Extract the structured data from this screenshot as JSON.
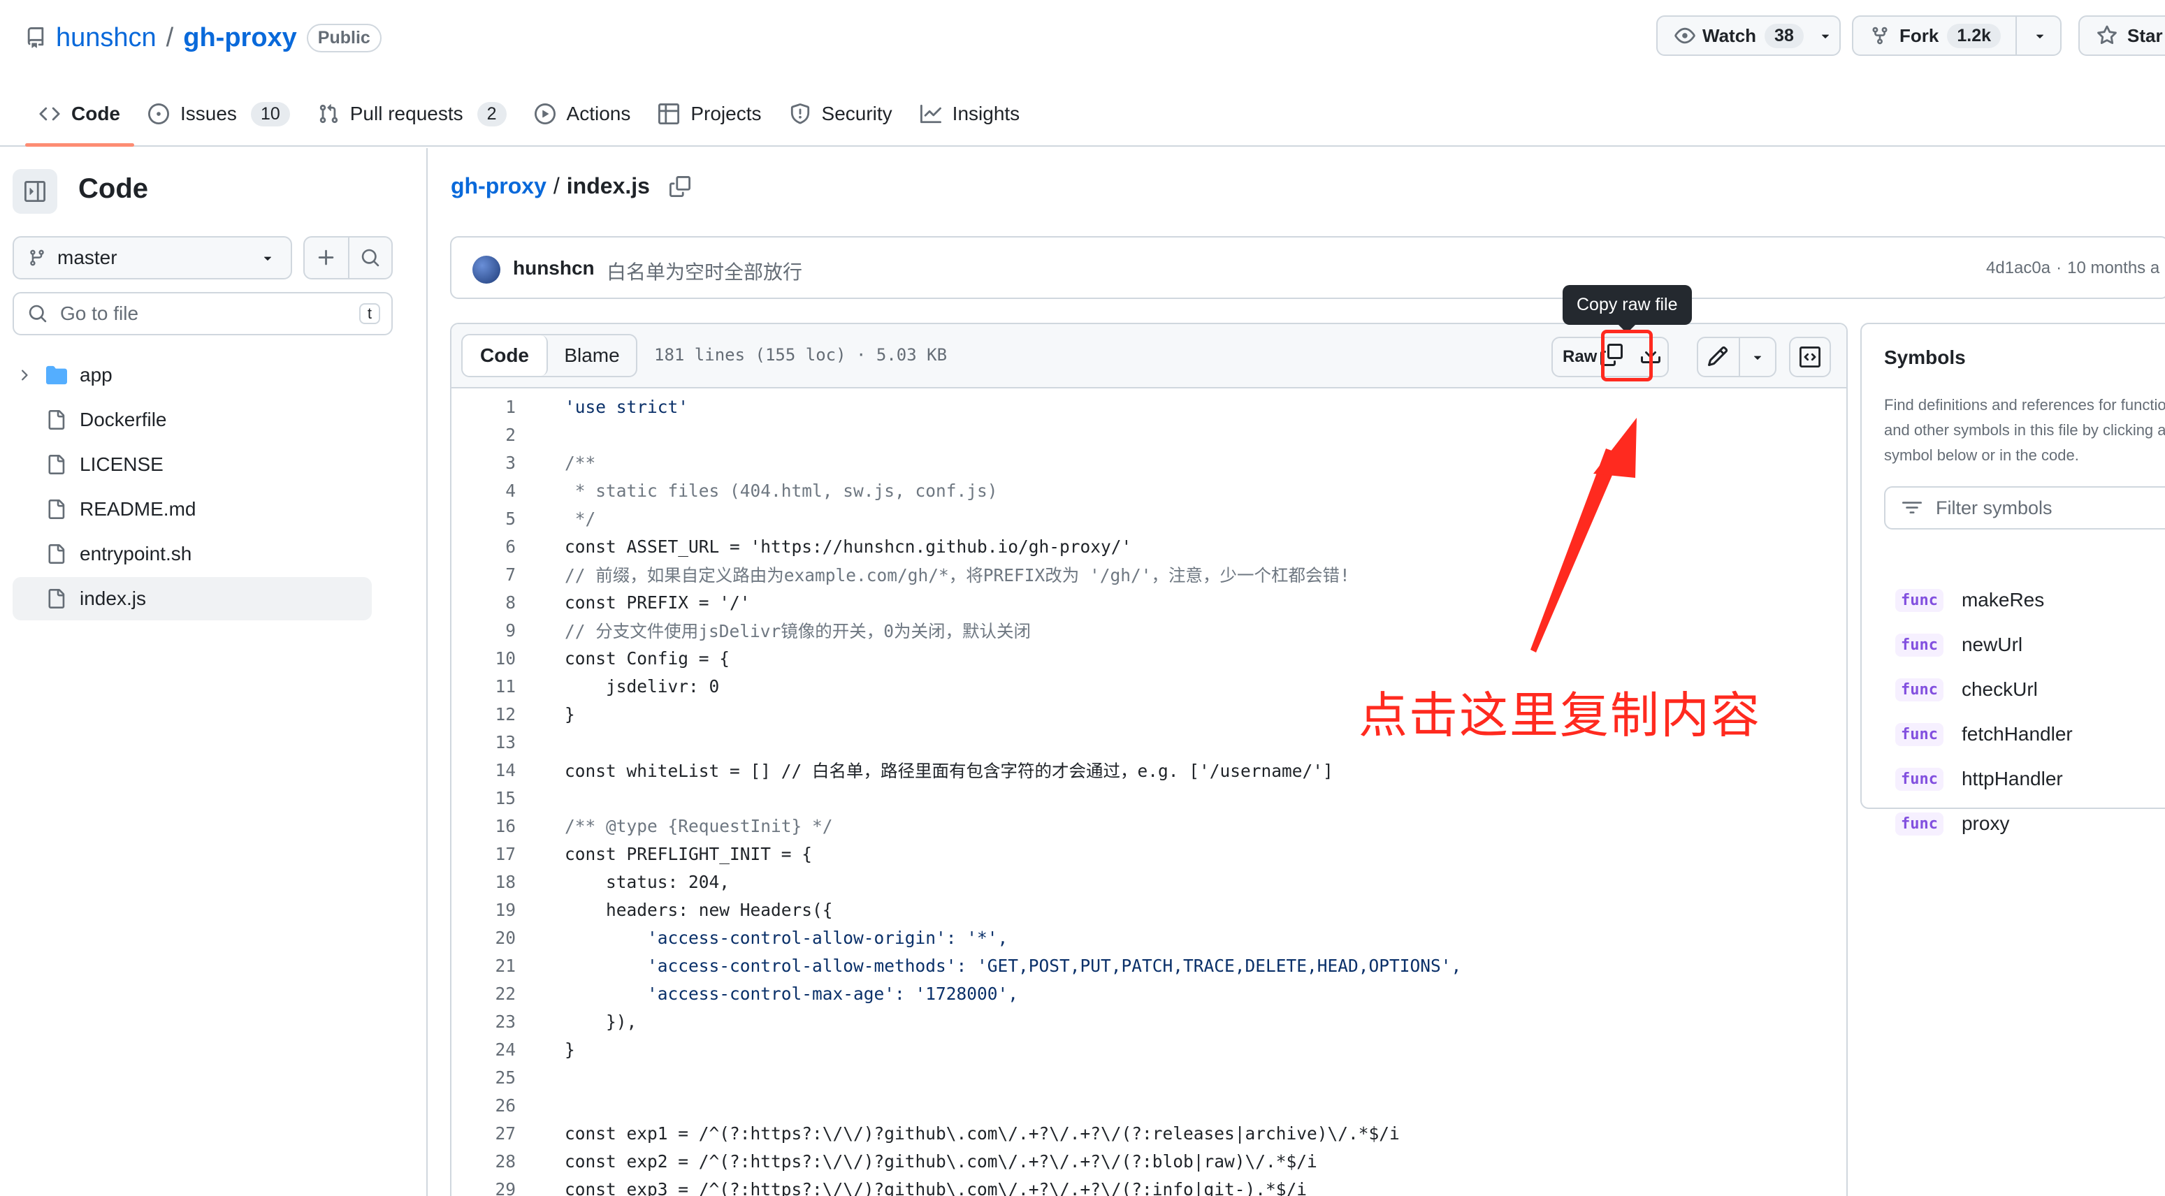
{
  "repo": {
    "owner": "hunshcn",
    "name": "gh-proxy",
    "visibility": "Public"
  },
  "header_actions": {
    "watch_label": "Watch",
    "watch_count": "38",
    "fork_label": "Fork",
    "fork_count": "1.2k",
    "star_label": "Star"
  },
  "tabs": [
    {
      "label": "Code",
      "count": null
    },
    {
      "label": "Issues",
      "count": "10"
    },
    {
      "label": "Pull requests",
      "count": "2"
    },
    {
      "label": "Actions",
      "count": null
    },
    {
      "label": "Projects",
      "count": null
    },
    {
      "label": "Security",
      "count": null
    },
    {
      "label": "Insights",
      "count": null
    }
  ],
  "sidebar": {
    "title": "Code",
    "branch": "master",
    "go_to_file_placeholder": "Go to file",
    "go_to_file_shortcut": "t",
    "files": [
      {
        "name": "app",
        "type": "folder"
      },
      {
        "name": "Dockerfile",
        "type": "file"
      },
      {
        "name": "LICENSE",
        "type": "file"
      },
      {
        "name": "README.md",
        "type": "file"
      },
      {
        "name": "entrypoint.sh",
        "type": "file"
      },
      {
        "name": "index.js",
        "type": "file"
      }
    ]
  },
  "breadcrumb": {
    "repo": "gh-proxy",
    "separator": "/",
    "file": "index.js"
  },
  "commit": {
    "author": "hunshcn",
    "message": "白名单为空时全部放行",
    "sha": "4d1ac0a",
    "separator": "·",
    "time": "10 months a"
  },
  "file_toolbar": {
    "code_tab": "Code",
    "blame_tab": "Blame",
    "meta": "181 lines (155 loc) · 5.03 KB",
    "raw_label": "Raw",
    "copy_tooltip": "Copy raw file"
  },
  "code_lines": [
    {
      "n": "1",
      "t": "'use strict'"
    },
    {
      "n": "2",
      "t": ""
    },
    {
      "n": "3",
      "t": "/**"
    },
    {
      "n": "4",
      "t": " * static files (404.html, sw.js, conf.js)"
    },
    {
      "n": "5",
      "t": " */"
    },
    {
      "n": "6",
      "t": "const ASSET_URL = 'https://hunshcn.github.io/gh-proxy/'"
    },
    {
      "n": "7",
      "t": "// 前缀，如果自定义路由为example.com/gh/*，将PREFIX改为 '/gh/'，注意，少一个杠都会错!"
    },
    {
      "n": "8",
      "t": "const PREFIX = '/'"
    },
    {
      "n": "9",
      "t": "// 分支文件使用jsDelivr镜像的开关，0为关闭，默认关闭"
    },
    {
      "n": "10",
      "t": "const Config = {"
    },
    {
      "n": "11",
      "t": "    jsdelivr: 0"
    },
    {
      "n": "12",
      "t": "}"
    },
    {
      "n": "13",
      "t": ""
    },
    {
      "n": "14",
      "t": "const whiteList = [] // 白名单，路径里面有包含字符的才会通过，e.g. ['/username/']"
    },
    {
      "n": "15",
      "t": ""
    },
    {
      "n": "16",
      "t": "/** @type {RequestInit} */"
    },
    {
      "n": "17",
      "t": "const PREFLIGHT_INIT = {"
    },
    {
      "n": "18",
      "t": "    status: 204,"
    },
    {
      "n": "19",
      "t": "    headers: new Headers({"
    },
    {
      "n": "20",
      "t": "        'access-control-allow-origin': '*',"
    },
    {
      "n": "21",
      "t": "        'access-control-allow-methods': 'GET,POST,PUT,PATCH,TRACE,DELETE,HEAD,OPTIONS',"
    },
    {
      "n": "22",
      "t": "        'access-control-max-age': '1728000',"
    },
    {
      "n": "23",
      "t": "    }),"
    },
    {
      "n": "24",
      "t": "}"
    },
    {
      "n": "25",
      "t": ""
    },
    {
      "n": "26",
      "t": ""
    },
    {
      "n": "27",
      "t": "const exp1 = /^(?:https?:\\/\\/)?github\\.com\\/.+?\\/.+?\\/(?:releases|archive)\\/.*$/i"
    },
    {
      "n": "28",
      "t": "const exp2 = /^(?:https?:\\/\\/)?github\\.com\\/.+?\\/.+?\\/(?:blob|raw)\\/.*$/i"
    },
    {
      "n": "29",
      "t": "const exp3 = /^(?:https?:\\/\\/)?github\\.com\\/.+?\\/.+?\\/(?:info|git-).*$/i"
    }
  ],
  "symbols": {
    "title": "Symbols",
    "description": "Find definitions and references for functions and other symbols in this file by clicking a symbol below or in the code.",
    "filter_placeholder": "Filter symbols",
    "tag": "func",
    "items": [
      "makeRes",
      "newUrl",
      "checkUrl",
      "fetchHandler",
      "httpHandler",
      "proxy"
    ]
  },
  "annotation": {
    "text": "点击这里复制内容",
    "color": "#ff2a1f"
  },
  "colors": {
    "link": "#0969da",
    "tab_underline": "#fd8c73",
    "border": "#d0d7de",
    "func": "#8250df"
  }
}
